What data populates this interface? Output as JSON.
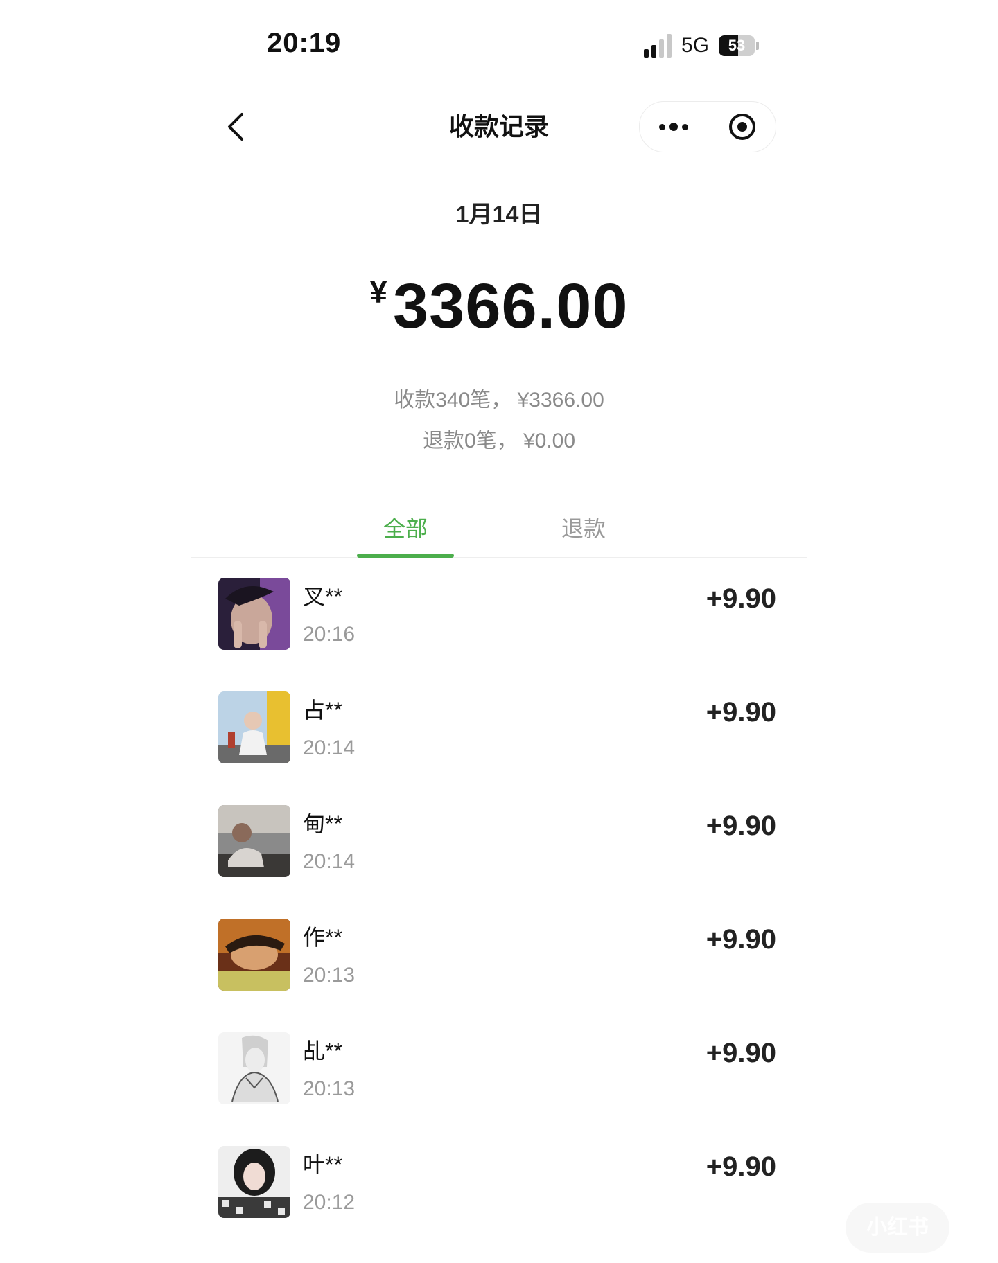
{
  "status_bar": {
    "time": "20:19",
    "network": "5G",
    "battery": "53",
    "battery_level": 0.53
  },
  "nav": {
    "title": "收款记录",
    "back_icon": "chevron-left-icon",
    "more_icon": "more-dots-icon",
    "close_icon": "target-circle-icon"
  },
  "summary": {
    "date": "1月14日",
    "currency_symbol": "¥",
    "total_amount": "3366.00",
    "received_line": "收款340笔， ¥3366.00",
    "refund_line": "退款0笔， ¥0.00"
  },
  "tabs": [
    {
      "label": "全部",
      "active": true
    },
    {
      "label": "退款",
      "active": false
    }
  ],
  "transactions": [
    {
      "name": "叉**",
      "time": "20:16",
      "amount": "+9.90"
    },
    {
      "name": "占**",
      "time": "20:14",
      "amount": "+9.90"
    },
    {
      "name": "甸**",
      "time": "20:14",
      "amount": "+9.90"
    },
    {
      "name": "作**",
      "time": "20:13",
      "amount": "+9.90"
    },
    {
      "name": "乩**",
      "time": "20:13",
      "amount": "+9.90"
    },
    {
      "name": "叶**",
      "time": "20:12",
      "amount": "+9.90"
    }
  ],
  "watermark": "小红书",
  "colors": {
    "accent": "#4cae4c",
    "text": "#111111",
    "muted": "#9a9a9a"
  }
}
